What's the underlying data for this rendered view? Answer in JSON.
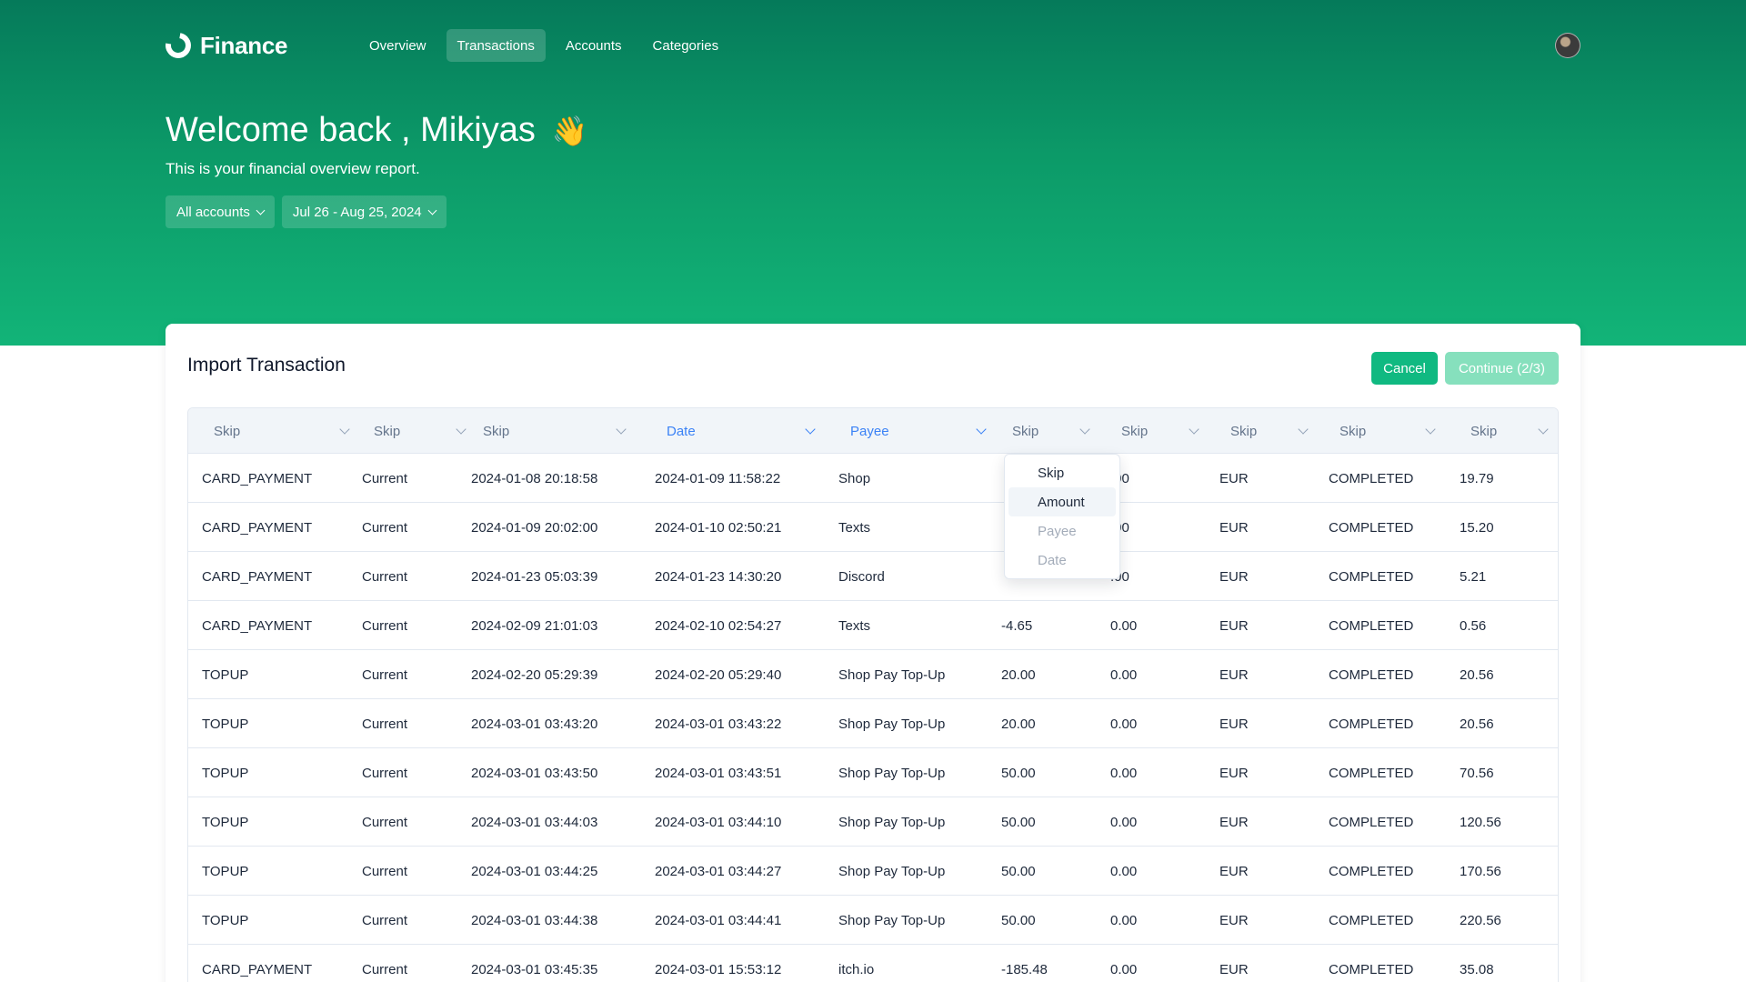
{
  "app": {
    "name": "Finance"
  },
  "nav": [
    {
      "label": "Overview",
      "active": false
    },
    {
      "label": "Transactions",
      "active": true
    },
    {
      "label": "Accounts",
      "active": false
    },
    {
      "label": "Categories",
      "active": false
    }
  ],
  "header": {
    "welcome": "Welcome back , Mikiyas",
    "wave_emoji": "👋",
    "subtitle": "This is your financial overview report."
  },
  "filters": {
    "account": "All accounts",
    "date_range": "Jul 26 - Aug 25, 2024"
  },
  "import": {
    "title": "Import Transaction",
    "cancel_label": "Cancel",
    "continue_label": "Continue (2/3)"
  },
  "columns": [
    {
      "label": "Skip",
      "mapped": false
    },
    {
      "label": "Skip",
      "mapped": false
    },
    {
      "label": "Skip",
      "mapped": false
    },
    {
      "label": "Date",
      "mapped": true
    },
    {
      "label": "Payee",
      "mapped": true
    },
    {
      "label": "Skip",
      "mapped": false
    },
    {
      "label": "Skip",
      "mapped": false
    },
    {
      "label": "Skip",
      "mapped": false
    },
    {
      "label": "Skip",
      "mapped": false
    },
    {
      "label": "Skip",
      "mapped": false
    }
  ],
  "rows": [
    [
      "CARD_PAYMENT",
      "Current",
      "2024-01-08 20:18:58",
      "2024-01-09 11:58:22",
      "Shop",
      "",
      ".00",
      "EUR",
      "COMPLETED",
      "19.79"
    ],
    [
      "CARD_PAYMENT",
      "Current",
      "2024-01-09 20:02:00",
      "2024-01-10 02:50:21",
      "Texts",
      "",
      ".00",
      "EUR",
      "COMPLETED",
      "15.20"
    ],
    [
      "CARD_PAYMENT",
      "Current",
      "2024-01-23 05:03:39",
      "2024-01-23 14:30:20",
      "Discord",
      "",
      ".00",
      "EUR",
      "COMPLETED",
      "5.21"
    ],
    [
      "CARD_PAYMENT",
      "Current",
      "2024-02-09 21:01:03",
      "2024-02-10 02:54:27",
      "Texts",
      "-4.65",
      "0.00",
      "EUR",
      "COMPLETED",
      "0.56"
    ],
    [
      "TOPUP",
      "Current",
      "2024-02-20 05:29:39",
      "2024-02-20 05:29:40",
      "Shop Pay Top-Up",
      "20.00",
      "0.00",
      "EUR",
      "COMPLETED",
      "20.56"
    ],
    [
      "TOPUP",
      "Current",
      "2024-03-01 03:43:20",
      "2024-03-01 03:43:22",
      "Shop Pay Top-Up",
      "20.00",
      "0.00",
      "EUR",
      "COMPLETED",
      "20.56"
    ],
    [
      "TOPUP",
      "Current",
      "2024-03-01 03:43:50",
      "2024-03-01 03:43:51",
      "Shop Pay Top-Up",
      "50.00",
      "0.00",
      "EUR",
      "COMPLETED",
      "70.56"
    ],
    [
      "TOPUP",
      "Current",
      "2024-03-01 03:44:03",
      "2024-03-01 03:44:10",
      "Shop Pay Top-Up",
      "50.00",
      "0.00",
      "EUR",
      "COMPLETED",
      "120.56"
    ],
    [
      "TOPUP",
      "Current",
      "2024-03-01 03:44:25",
      "2024-03-01 03:44:27",
      "Shop Pay Top-Up",
      "50.00",
      "0.00",
      "EUR",
      "COMPLETED",
      "170.56"
    ],
    [
      "TOPUP",
      "Current",
      "2024-03-01 03:44:38",
      "2024-03-01 03:44:41",
      "Shop Pay Top-Up",
      "50.00",
      "0.00",
      "EUR",
      "COMPLETED",
      "220.56"
    ],
    [
      "CARD_PAYMENT",
      "Current",
      "2024-03-01 03:45:35",
      "2024-03-01 15:53:12",
      "itch.io",
      "-185.48",
      "0.00",
      "EUR",
      "COMPLETED",
      "35.08"
    ]
  ],
  "column_dropdown": {
    "options": [
      {
        "label": "Skip",
        "state": "normal"
      },
      {
        "label": "Amount",
        "state": "highlighted"
      },
      {
        "label": "Payee",
        "state": "disabled"
      },
      {
        "label": "Date",
        "state": "disabled"
      }
    ]
  },
  "colors": {
    "brand_green": "#10b981",
    "hero_dark": "#057a5a",
    "mapped_blue": "#3b82f6"
  }
}
